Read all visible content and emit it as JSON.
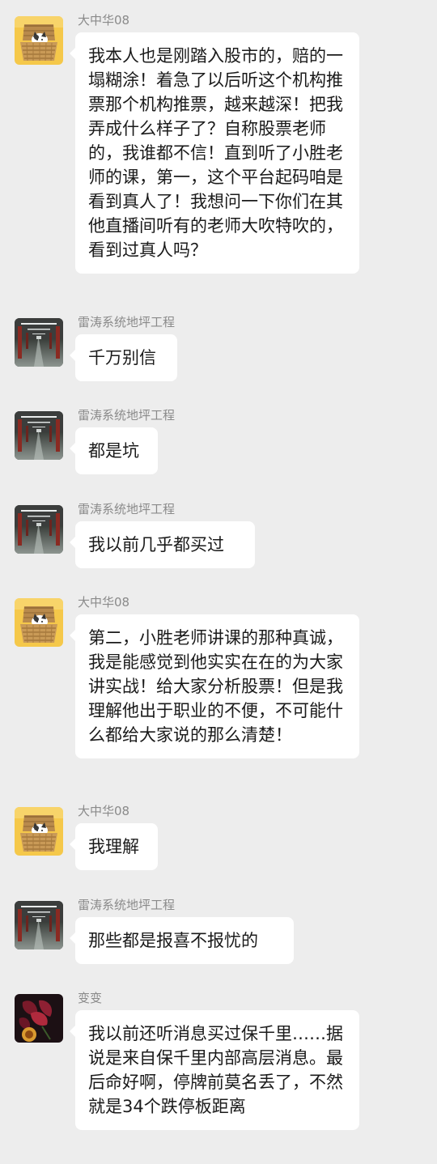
{
  "colors": {
    "background": "#ededed",
    "bubble": "#ffffff",
    "sender_name": "#8a8a8a",
    "message_text": "#1a1a1a"
  },
  "messages": [
    {
      "sender": "大中华08",
      "avatar": "cat-in-basket-avatar",
      "text": "我本人也是刚踏入股市的，赔的一塌糊涂！着急了以后听这个机构推票那个机构推票，越来越深！把我弄成什么样子了？自称股票老师的，我谁都不信！直到听了小胜老师的课，第一，这个平台起码咱是看到真人了！我想问一下你们在其他直播间听有的老师大吹特吹的，看到过真人吗？"
    },
    {
      "sender": "雷涛系统地坪工程",
      "avatar": "parking-garage-avatar",
      "text": "千万别信"
    },
    {
      "sender": "雷涛系统地坪工程",
      "avatar": "parking-garage-avatar",
      "text": "都是坑"
    },
    {
      "sender": "雷涛系统地坪工程",
      "avatar": "parking-garage-avatar",
      "text": "我以前几乎都买过"
    },
    {
      "sender": "大中华08",
      "avatar": "cat-in-basket-avatar",
      "text": "第二，小胜老师讲课的那种真诚，我是能感觉到他实实在在的为大家讲实战！给大家分析股票！但是我理解他出于职业的不便，不可能什么都给大家说的那么清楚！"
    },
    {
      "sender": "大中华08",
      "avatar": "cat-in-basket-avatar",
      "text": "我理解"
    },
    {
      "sender": "雷涛系统地坪工程",
      "avatar": "parking-garage-avatar",
      "text": "那些都是报喜不报忧的"
    },
    {
      "sender": "变变",
      "avatar": "red-flower-avatar",
      "text": "我以前还听消息买过保千里……据说是来自保千里内部高层消息。最后命好啊，停牌前莫名丢了，不然就是34个跌停板距离"
    }
  ]
}
